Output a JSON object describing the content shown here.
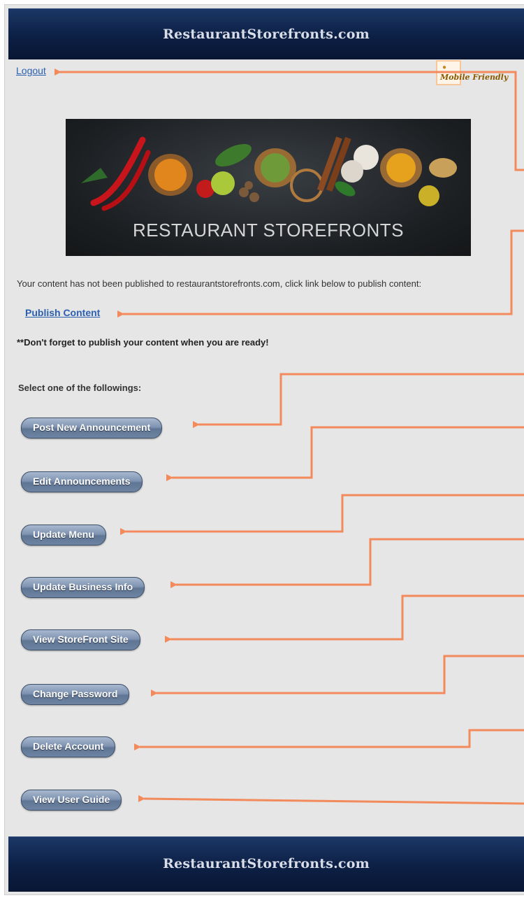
{
  "header": {
    "title": "RestaurantStorefronts.com"
  },
  "footer": {
    "title": "RestaurantStorefronts.com"
  },
  "logout_label": "Logout",
  "mobile_badge": {
    "label": "Mobile Friendly"
  },
  "banner": {
    "title": "RESTAURANT STOREFRONTS"
  },
  "notice": "Your content has not been published to restaurantstorefronts.com, click link below to publish content:",
  "publish_label": "Publish Content",
  "reminder": "**Don't forget to publish your content when you are ready!",
  "select_label": "Select one of the followings:",
  "buttons": [
    "Post New Announcement",
    "Edit Announcements",
    "Update Menu",
    "Update Business Info",
    "View StoreFront Site",
    "Change Password",
    "Delete Account",
    "View User Guide"
  ],
  "colors": {
    "accent_arrow": "#f28a5c",
    "header_bar": "#0c1f44",
    "link": "#2b5fb0"
  }
}
